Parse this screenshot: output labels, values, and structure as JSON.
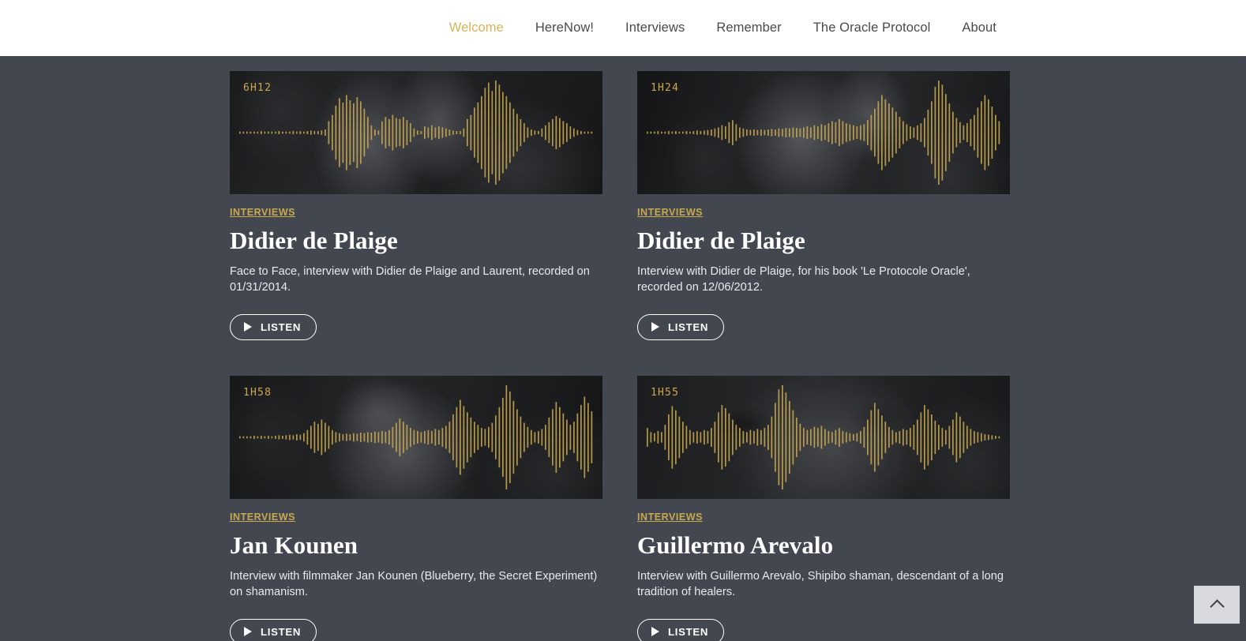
{
  "header": {
    "nav": [
      {
        "label": "Welcome",
        "active": true
      },
      {
        "label": "HereNow!",
        "active": false
      },
      {
        "label": "Interviews",
        "active": false
      },
      {
        "label": "Remember",
        "active": false
      },
      {
        "label": "The Oracle Protocol",
        "active": false
      },
      {
        "label": "About",
        "active": false
      }
    ]
  },
  "colors": {
    "accent_gold": "#c9a94f",
    "nav_active": "#d8b458",
    "page_background": "#424750",
    "header_background": "#ffffff",
    "card_title": "#ffffff",
    "back_to_top_background": "#d8dade"
  },
  "cards": [
    {
      "duration": "6H12",
      "category": "INTERVIEWS",
      "title": "Didier de Plaige",
      "description": "Face to Face, interview with Didier de Plaige and Laurent, recorded on 01/31/2014.",
      "button_label": "LISTEN",
      "icon": "play-icon",
      "waveform": [
        2,
        2,
        2,
        2,
        2,
        2,
        3,
        2,
        2,
        2,
        2,
        3,
        2,
        2,
        2,
        3,
        2,
        3,
        2,
        3,
        4,
        3,
        3,
        4,
        6,
        22,
        34,
        52,
        66,
        58,
        72,
        62,
        56,
        68,
        60,
        46,
        30,
        14,
        6,
        4,
        22,
        30,
        26,
        34,
        28,
        26,
        30,
        24,
        18,
        8,
        4,
        3,
        12,
        10,
        14,
        10,
        12,
        10,
        8,
        6,
        4,
        3,
        3,
        8,
        26,
        34,
        48,
        58,
        70,
        86,
        96,
        80,
        100,
        92,
        78,
        70,
        58,
        46,
        36,
        26,
        18,
        10,
        6,
        4,
        3,
        8,
        14,
        20,
        26,
        32,
        28,
        22,
        18,
        12,
        8,
        5,
        3,
        2,
        2,
        2
      ]
    },
    {
      "duration": "1H24",
      "category": "INTERVIEWS",
      "title": "Didier de Plaige",
      "description": "Interview with Didier de Plaige, for his book 'Le Protocole Oracle', recorded on 12/06/2012.",
      "button_label": "LISTEN",
      "icon": "play-icon",
      "waveform": [
        2,
        2,
        2,
        3,
        2,
        2,
        3,
        2,
        3,
        2,
        2,
        3,
        2,
        3,
        4,
        3,
        4,
        5,
        6,
        8,
        10,
        14,
        12,
        20,
        24,
        16,
        10,
        8,
        6,
        5,
        6,
        5,
        6,
        5,
        6,
        7,
        6,
        8,
        7,
        9,
        8,
        10,
        9,
        8,
        10,
        12,
        10,
        14,
        12,
        16,
        14,
        18,
        22,
        20,
        26,
        22,
        18,
        16,
        14,
        12,
        14,
        16,
        24,
        34,
        46,
        60,
        72,
        64,
        56,
        48,
        40,
        30,
        22,
        16,
        12,
        10,
        14,
        18,
        28,
        44,
        60,
        88,
        100,
        92,
        74,
        56,
        40,
        28,
        20,
        14,
        18,
        26,
        34,
        48,
        60,
        72,
        64,
        50,
        34,
        22
      ]
    },
    {
      "duration": "1H58",
      "category": "INTERVIEWS",
      "title": "Jan Kounen",
      "description": "Interview with filmmaker Jan Kounen (Blueberry, the Secret Experiment) on shamanism.",
      "button_label": "LISTEN",
      "icon": "play-icon",
      "waveform": [
        2,
        2,
        2,
        2,
        3,
        2,
        3,
        2,
        3,
        2,
        3,
        4,
        3,
        4,
        5,
        4,
        6,
        5,
        8,
        14,
        22,
        30,
        26,
        34,
        28,
        22,
        14,
        10,
        8,
        6,
        7,
        6,
        8,
        7,
        9,
        8,
        10,
        9,
        11,
        10,
        12,
        11,
        14,
        20,
        28,
        36,
        30,
        24,
        18,
        14,
        12,
        10,
        12,
        14,
        12,
        16,
        14,
        18,
        22,
        30,
        44,
        58,
        72,
        60,
        48,
        38,
        30,
        24,
        18,
        16,
        20,
        28,
        42,
        58,
        76,
        100,
        88,
        70,
        54,
        40,
        28,
        20,
        14,
        10,
        12,
        16,
        24,
        38,
        54,
        68,
        58,
        46,
        34,
        24,
        30,
        46,
        62,
        78,
        66,
        50
      ]
    },
    {
      "duration": "1H55",
      "category": "INTERVIEWS",
      "title": "Guillermo Arevalo",
      "description": "Interview with Guillermo Arevalo, Shipibo shaman, descendant of a long tradition of healers.",
      "button_label": "LISTEN",
      "icon": "play-icon",
      "waveform": [
        18,
        10,
        8,
        12,
        10,
        24,
        44,
        60,
        52,
        40,
        30,
        22,
        14,
        10,
        12,
        10,
        14,
        12,
        18,
        30,
        48,
        62,
        56,
        46,
        34,
        24,
        18,
        12,
        10,
        14,
        12,
        16,
        14,
        18,
        24,
        40,
        66,
        92,
        100,
        86,
        70,
        52,
        38,
        26,
        18,
        14,
        16,
        20,
        18,
        22,
        16,
        12,
        10,
        14,
        18,
        12,
        10,
        8,
        6,
        8,
        12,
        20,
        34,
        52,
        66,
        54,
        42,
        30,
        20,
        14,
        10,
        12,
        16,
        14,
        18,
        24,
        34,
        48,
        62,
        54,
        44,
        32,
        24,
        18,
        14,
        22,
        34,
        48,
        40,
        30,
        22,
        16,
        12,
        10,
        8,
        6,
        5,
        4,
        3,
        2
      ]
    }
  ],
  "back_to_top": {
    "icon": "chevron-up-icon",
    "label": ""
  }
}
